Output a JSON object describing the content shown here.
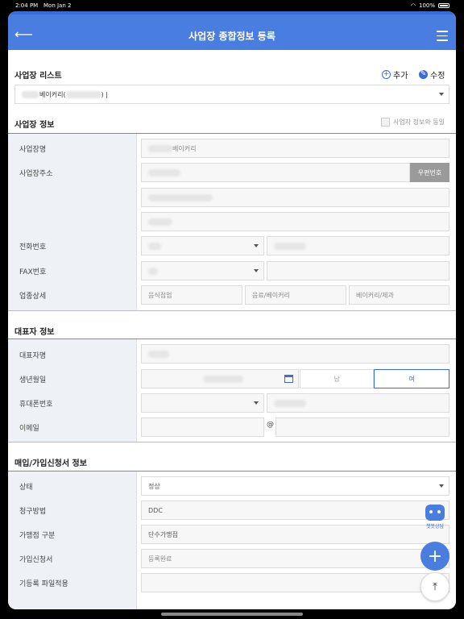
{
  "status_bar": {
    "time": "2:04 PM",
    "date": "Mon Jan 2",
    "battery": "100%"
  },
  "header": {
    "title": "사업장 종합정보 등록"
  },
  "business_list": {
    "title": "사업장 리스트",
    "add_label": "추가",
    "edit_label": "수정",
    "selected_text": "베이커리(",
    "selected_suffix": ") |"
  },
  "business_info": {
    "title": "사업장 정보",
    "same_as_owner": "사업자 정보와 동일",
    "name_label": "사업장명",
    "name_value": "베이커리",
    "address_label": "사업장주소",
    "postcode_button": "우편번호",
    "phone_label": "전화번호",
    "fax_label": "FAX번호",
    "business_type_label": "업종상세",
    "business_type_values": [
      "음식점업",
      "음료/베이커리",
      "베이커리/제과"
    ]
  },
  "representative": {
    "title": "대표자 정보",
    "name_label": "대표자명",
    "birth_label": "생년월일",
    "gender_male": "남",
    "gender_female": "여",
    "mobile_label": "휴대폰번호",
    "email_label": "이메일",
    "at_sign": "@"
  },
  "subscription": {
    "title": "매입/가입신청서 정보",
    "status_label": "상태",
    "status_value": "정상",
    "billing_label": "청구방법",
    "billing_value": "DDC",
    "merchant_type_label": "가맹점 구분",
    "merchant_type_value": "단수가맹점",
    "application_label": "가입신청서",
    "application_value": "등록완료",
    "file_label": "기등록 파일적용"
  },
  "chatbot": {
    "label": "챗봇상담"
  },
  "colors": {
    "primary": "#4a7de0",
    "accent": "#3a6cd8"
  }
}
